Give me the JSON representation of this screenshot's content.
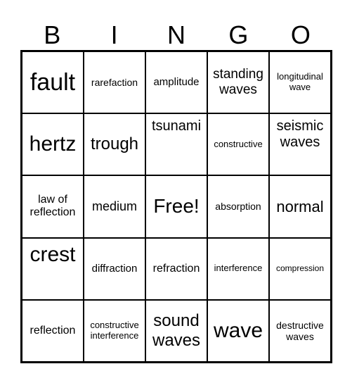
{
  "header": [
    "B",
    "I",
    "N",
    "G",
    "O"
  ],
  "cells": [
    [
      "fault",
      "rarefaction",
      "amplitude",
      "standing waves",
      "longitudinal wave"
    ],
    [
      "hertz",
      "trough",
      "tsunami",
      "constructive",
      "seismic waves"
    ],
    [
      "law of reflection",
      "medium",
      "Free!",
      "absorption",
      "normal"
    ],
    [
      "crest",
      "diffraction",
      "refraction",
      "interference",
      "compression"
    ],
    [
      "reflection",
      "constructive interference",
      "sound waves",
      "wave",
      "destructive waves"
    ]
  ]
}
